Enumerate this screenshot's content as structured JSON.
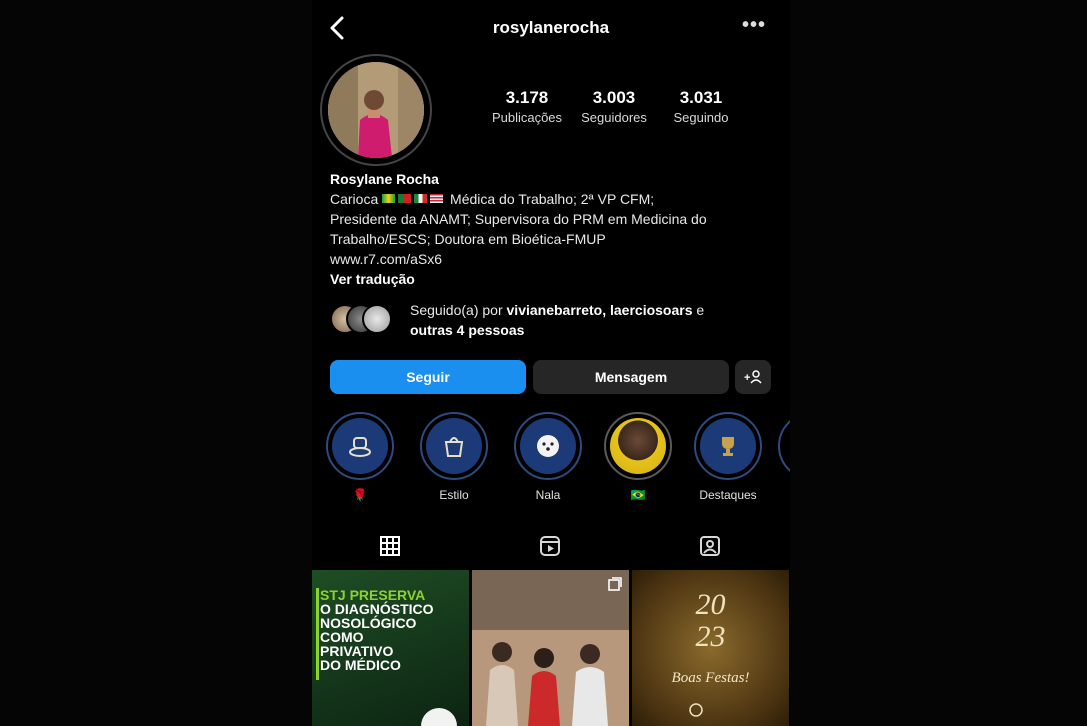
{
  "header": {
    "username": "rosylanerocha",
    "more_label": "•••"
  },
  "stats": [
    {
      "value": "3.178",
      "label": "Publicações"
    },
    {
      "value": "3.003",
      "label": "Seguidores"
    },
    {
      "value": "3.031",
      "label": "Seguindo"
    }
  ],
  "bio": {
    "name": "Rosylane Rocha",
    "line1_prefix": "Carioca",
    "line1_suffix": "Médica do Trabalho; 2ª VP CFM;",
    "line2": "Presidente da ANAMT; Supervisora do PRM em Medicina do",
    "line3": "Trabalho/ESCS; Doutora em Bioética-FMUP",
    "link": "www.r7.com/aSx6",
    "translate": "Ver tradução"
  },
  "followed_by": {
    "prefix": "Seguido(a) por ",
    "names": "vivianebarreto, laerciosoars",
    "joiner": " e ",
    "others": "outras 4 pessoas"
  },
  "actions": {
    "follow": "Seguir",
    "message": "Mensagem",
    "add_user": "+♀"
  },
  "highlights": [
    {
      "label": "🌹",
      "icon": "dinner-icon"
    },
    {
      "label": "Estilo",
      "icon": "bag-icon"
    },
    {
      "label": "Nala",
      "icon": "dog-icon"
    },
    {
      "label": "🇧🇷",
      "icon": "selfie-photo"
    },
    {
      "label": "Destaques",
      "icon": "trophy-icon"
    }
  ],
  "tabs": [
    "grid-icon",
    "reels-icon",
    "tagged-icon"
  ],
  "posts": {
    "post1": {
      "line1": "STJ PRESERVA",
      "line2": "O DIAGNÓSTICO",
      "line3": "NOSOLÓGICO",
      "line4": "COMO PRIVATIVO",
      "line5": "DO MÉDICO"
    },
    "post3": {
      "year_top": "20",
      "year_bottom": "23",
      "greeting": "Boas Festas!"
    }
  },
  "colors": {
    "follow_button": "#1a8ff0",
    "secondary_button": "#262626",
    "highlight_bg": "#1d3a78",
    "post_green": "#8bd32f"
  }
}
